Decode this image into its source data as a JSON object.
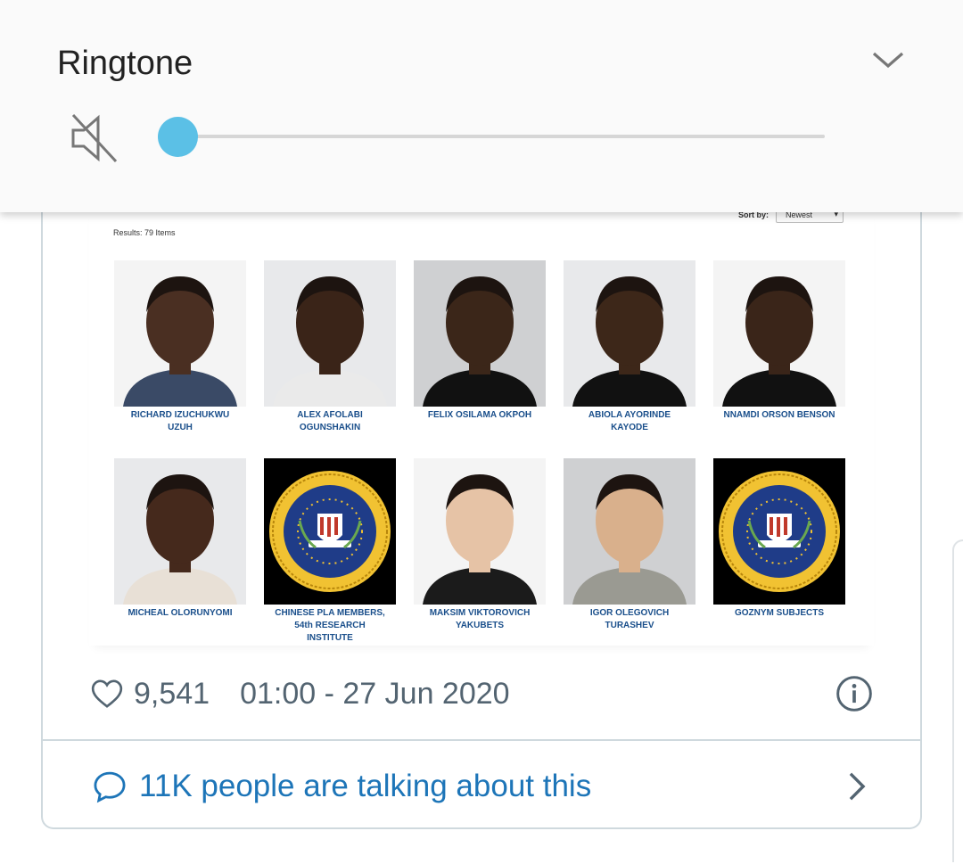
{
  "volume_panel": {
    "title": "Ringtone",
    "level": 0,
    "muted": true,
    "accent_color": "#5bc0e6",
    "icons": [
      "speaker-muted-icon",
      "chevron-down-icon"
    ]
  },
  "embedded_image": {
    "results_label": "Results: 79 Items",
    "sort_label": "Sort by:",
    "sort_value": "Newest",
    "items": [
      {
        "name_line1": "RICHARD IZUCHUKWU",
        "name_line2": "UZUH",
        "name_line3": "",
        "kind": "photo",
        "bg": "white"
      },
      {
        "name_line1": "ALEX AFOLABI",
        "name_line2": "OGUNSHAKIN",
        "name_line3": "",
        "kind": "photo",
        "bg": "light"
      },
      {
        "name_line1": "FELIX OSILAMA OKPOH",
        "name_line2": "",
        "name_line3": "",
        "kind": "photo",
        "bg": "grey"
      },
      {
        "name_line1": "ABIOLA AYORINDE",
        "name_line2": "KAYODE",
        "name_line3": "",
        "kind": "photo",
        "bg": "light"
      },
      {
        "name_line1": "NNAMDI ORSON BENSON",
        "name_line2": "",
        "name_line3": "",
        "kind": "photo",
        "bg": "white"
      },
      {
        "name_line1": "MICHEAL OLORUNYOMI",
        "name_line2": "",
        "name_line3": "",
        "kind": "photo",
        "bg": "light"
      },
      {
        "name_line1": "CHINESE PLA MEMBERS,",
        "name_line2": "54th RESEARCH",
        "name_line3": "INSTITUTE",
        "kind": "seal",
        "bg": "black"
      },
      {
        "name_line1": "MAKSIM VIKTOROVICH",
        "name_line2": "YAKUBETS",
        "name_line3": "",
        "kind": "photo",
        "bg": "white"
      },
      {
        "name_line1": "IGOR OLEGOVICH",
        "name_line2": "TURASHEV",
        "name_line3": "",
        "kind": "photo",
        "bg": "grey"
      },
      {
        "name_line1": "GOZNYM SUBJECTS",
        "name_line2": "",
        "name_line3": "",
        "kind": "seal",
        "bg": "black"
      }
    ],
    "seal_text": "DEPARTMENT OF JUSTICE · FEDERAL BUREAU OF INVESTIGATION"
  },
  "tweet": {
    "like_count": "9,541",
    "timestamp": "01:00 - 27 Jun 2020",
    "talking": "11K people are talking about this",
    "link_color": "#1d75b8",
    "icons": [
      "heart-icon",
      "info-icon",
      "speech-bubble-icon",
      "chevron-right-icon"
    ]
  }
}
